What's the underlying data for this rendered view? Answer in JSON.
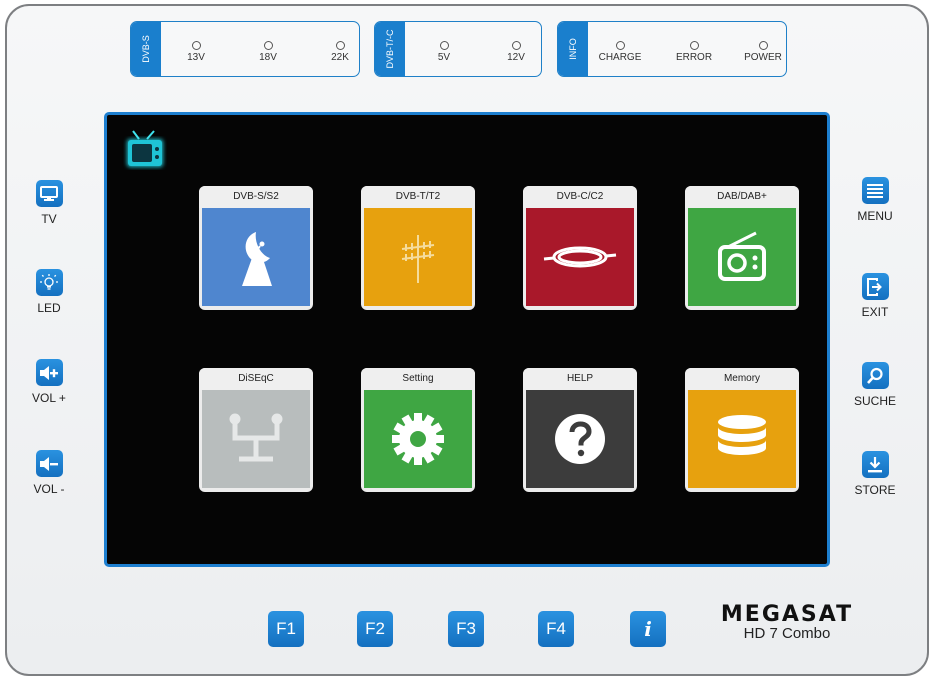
{
  "device": {
    "led_groups": [
      {
        "tag": "DVB-S",
        "leds": [
          "13V",
          "18V",
          "22K"
        ]
      },
      {
        "tag": "DVB-T/-C",
        "leds": [
          "5V",
          "12V"
        ]
      },
      {
        "tag": "INFO",
        "leds": [
          "CHARGE",
          "ERROR",
          "POWER"
        ]
      }
    ],
    "left_buttons": [
      {
        "label": "TV",
        "icon": "monitor-icon"
      },
      {
        "label": "LED",
        "icon": "bulb-icon"
      },
      {
        "label": "VOL +",
        "icon": "volume-up-icon"
      },
      {
        "label": "VOL -",
        "icon": "volume-down-icon"
      }
    ],
    "right_buttons": [
      {
        "label": "MENU",
        "icon": "menu-icon"
      },
      {
        "label": "EXIT",
        "icon": "exit-icon"
      },
      {
        "label": "SUCHE",
        "icon": "search-icon"
      },
      {
        "label": "STORE",
        "icon": "download-icon"
      }
    ],
    "function_keys": [
      "F1",
      "F2",
      "F3",
      "F4"
    ],
    "info_key": "i",
    "brand": "MEGASAT",
    "model": "HD 7 Combo"
  },
  "menu": {
    "tiles": [
      {
        "label": "DVB-S/S2",
        "color": "#4f86cf",
        "icon": "satellite-dish-icon"
      },
      {
        "label": "DVB-T/T2",
        "color": "#e7a10e",
        "icon": "antenna-icon"
      },
      {
        "label": "DVB-C/C2",
        "color": "#a9182a",
        "icon": "cable-icon"
      },
      {
        "label": "DAB/DAB+",
        "color": "#3fa643",
        "icon": "radio-icon"
      },
      {
        "label": "DiSEqC",
        "color": "#b8bdbd",
        "icon": "diseqc-switch-icon"
      },
      {
        "label": "Setting",
        "color": "#3fa643",
        "icon": "gear-icon"
      },
      {
        "label": "HELP",
        "color": "#3c3c3c",
        "icon": "question-icon"
      },
      {
        "label": "Memory",
        "color": "#e7a10e",
        "icon": "database-icon"
      }
    ]
  }
}
